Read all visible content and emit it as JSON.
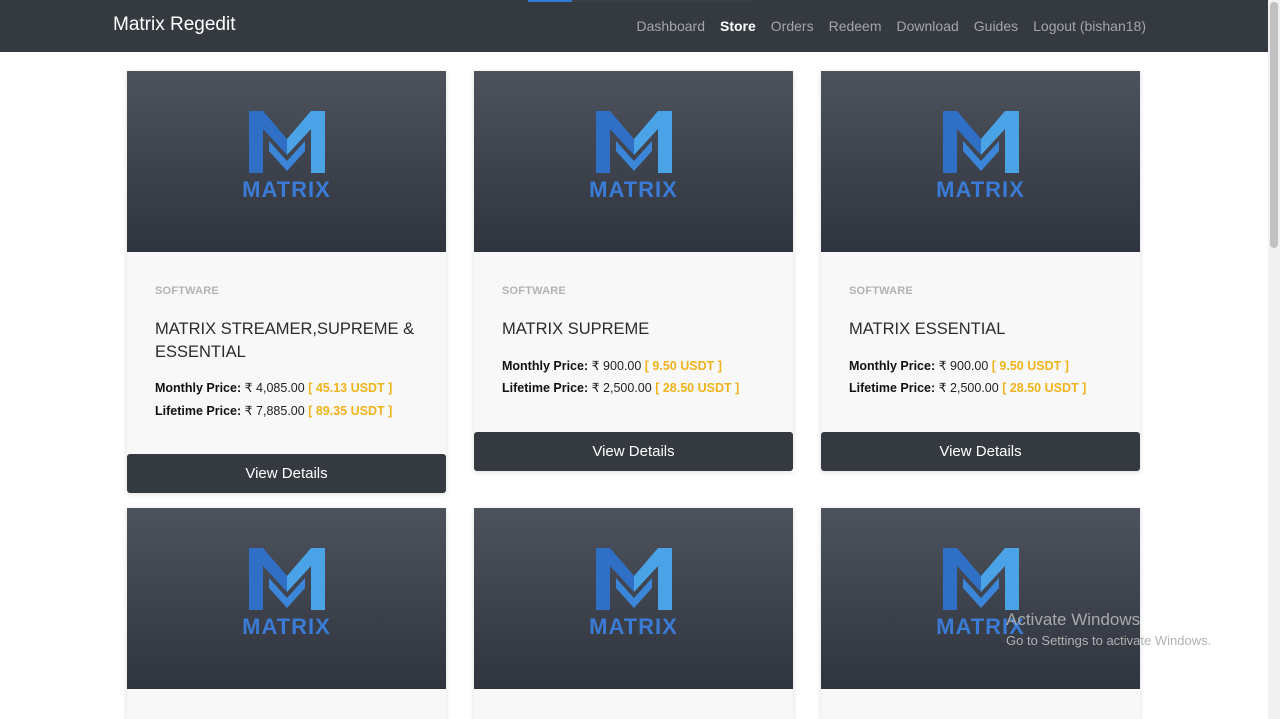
{
  "brand": "Matrix Regedit",
  "nav": [
    {
      "label": "Dashboard",
      "active": false
    },
    {
      "label": "Store",
      "active": true
    },
    {
      "label": "Orders",
      "active": false
    },
    {
      "label": "Redeem",
      "active": false
    },
    {
      "label": "Download",
      "active": false
    },
    {
      "label": "Guides",
      "active": false
    },
    {
      "label": "Logout (bishan18)",
      "active": false
    }
  ],
  "logo_text": "MATRIX",
  "monthly_label": "Monthly Price:",
  "lifetime_label": "Lifetime Price:",
  "button_label": "View Details",
  "products": [
    {
      "category": "SOFTWARE",
      "title": "MATRIX STREAMER,SUPREME & ESSENTIAL",
      "monthly_inr": "₹ 4,085.00",
      "monthly_usdt": "[ 45.13 USDT ]",
      "lifetime_inr": "₹ 7,885.00",
      "lifetime_usdt": "[ 89.35 USDT ]"
    },
    {
      "category": "SOFTWARE",
      "title": "MATRIX SUPREME",
      "monthly_inr": "₹ 900.00",
      "monthly_usdt": "[ 9.50 USDT ]",
      "lifetime_inr": "₹ 2,500.00",
      "lifetime_usdt": "[ 28.50 USDT ]"
    },
    {
      "category": "SOFTWARE",
      "title": "MATRIX ESSENTIAL",
      "monthly_inr": "₹ 900.00",
      "monthly_usdt": "[ 9.50 USDT ]",
      "lifetime_inr": "₹ 2,500.00",
      "lifetime_usdt": "[ 28.50 USDT ]"
    }
  ],
  "watermark": {
    "title": "Activate Windows",
    "subtitle": "Go to Settings to activate Windows."
  },
  "colors": {
    "navbar": "#343a40",
    "accent": "#2f7cd6",
    "logo_blue": "#3a7bd5",
    "usdt": "#f1b31c"
  }
}
